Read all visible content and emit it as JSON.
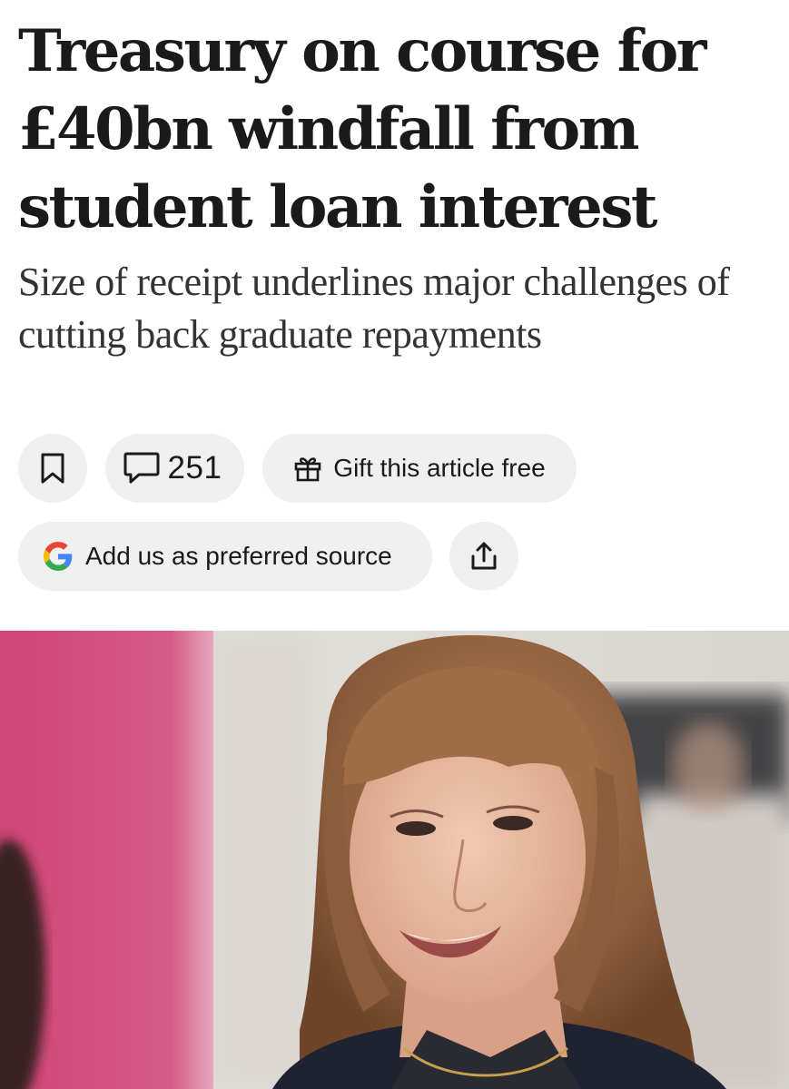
{
  "article": {
    "headline": "Treasury on course for £40bn windfall from student loan interest",
    "standfirst": "Size of receipt underlines major challenges of cutting back graduate repayments"
  },
  "actions": {
    "save_icon": "bookmark-icon",
    "comments_icon": "speech-bubble-icon",
    "comments_count": "251",
    "gift_icon": "gift-icon",
    "gift_label": "Gift this article free",
    "source_icon": "google-g-icon",
    "source_label": "Add us as preferred source",
    "share_icon": "share-icon"
  },
  "hero_image": {
    "subject": "photo of a smiling woman with shoulder-length auburn hair and fringe",
    "colors": {
      "left_wall": "#d5517f",
      "background": "#e3dfdb",
      "hair": "#9a6a45",
      "jacket": "#1f2230"
    }
  },
  "theme": {
    "text_color": "#1a1a1a",
    "pill_background": "#f0f0f0",
    "google_blue": "#4285F4",
    "google_red": "#EA4335",
    "google_yellow": "#FBBC05",
    "google_green": "#34A853"
  }
}
